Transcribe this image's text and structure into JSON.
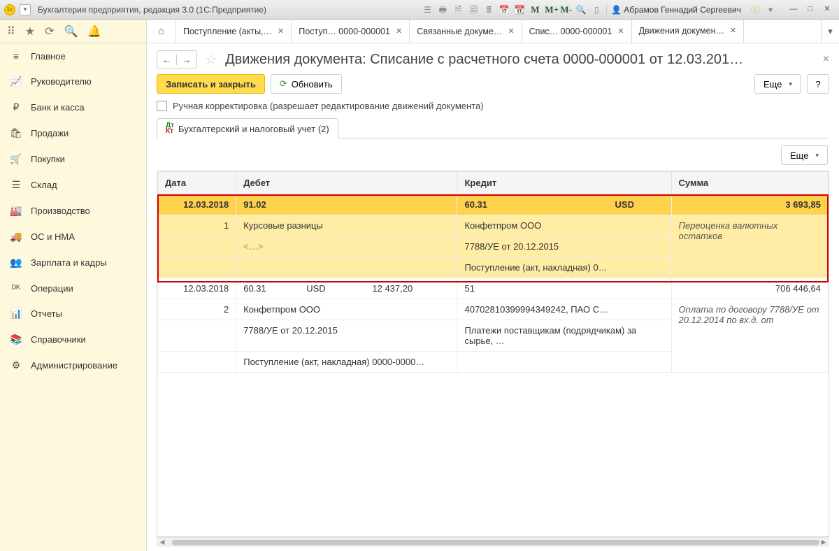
{
  "titlebar": {
    "title": "Бухгалтерия предприятия, редакция 3.0  (1С:Предприятие)",
    "m_labels": [
      "M",
      "M+",
      "M-"
    ],
    "user": "Абрамов Геннадий Сергеевич"
  },
  "sidebar": {
    "items": [
      {
        "icon": "≡",
        "label": "Главное"
      },
      {
        "icon": "📈",
        "label": "Руководителю"
      },
      {
        "icon": "₽",
        "label": "Банк и касса"
      },
      {
        "icon": "🛍",
        "label": "Продажи"
      },
      {
        "icon": "🛒",
        "label": "Покупки"
      },
      {
        "icon": "☰",
        "label": "Склад"
      },
      {
        "icon": "🏭",
        "label": "Производство"
      },
      {
        "icon": "🚚",
        "label": "ОС и НМА"
      },
      {
        "icon": "👥",
        "label": "Зарплата и кадры"
      },
      {
        "icon": "ᴰᴷ",
        "label": "Операции"
      },
      {
        "icon": "📊",
        "label": "Отчеты"
      },
      {
        "icon": "📚",
        "label": "Справочники"
      },
      {
        "icon": "⚙",
        "label": "Администрирование"
      }
    ]
  },
  "tabs": [
    {
      "label": "Поступление (акты,…"
    },
    {
      "label": "Поступ… 0000-000001"
    },
    {
      "label": "Связанные докуме…"
    },
    {
      "label": "Спис… 0000-000001"
    },
    {
      "label": "Движения докумен…",
      "active": true
    }
  ],
  "page": {
    "title": "Движения документа: Списание с расчетного счета 0000-000001 от 12.03.201…",
    "save_close": "Записать и закрыть",
    "refresh": "Обновить",
    "more": "Еще",
    "help": "?",
    "manual_correction": "Ручная корректировка (разрешает редактирование движений документа)",
    "inner_tab": "Бухгалтерский и налоговый учет (2)"
  },
  "table": {
    "headers": {
      "date": "Дата",
      "debit": "Дебет",
      "credit": "Кредит",
      "sum": "Сумма"
    },
    "group1": {
      "date": "12.03.2018",
      "num": "1",
      "debit_acct": "91.02",
      "debit_l1": "Курсовые разницы",
      "debit_l2": "<…>",
      "credit_acct": "60.31",
      "credit_cur": "USD",
      "credit_l1": "Конфетпром ООО",
      "credit_l2": "7788/УЕ от 20.12.2015",
      "credit_l3": "Поступление (акт, накладная) 0…",
      "sum": "3 693,85",
      "sum_desc": "Переоценка валютных остатков"
    },
    "group2": {
      "date": "12.03.2018",
      "num": "2",
      "debit_acct": "60.31",
      "debit_cur": "USD",
      "debit_amt": "12 437,20",
      "debit_l1": "Конфетпром ООО",
      "debit_l2": "7788/УЕ от 20.12.2015",
      "debit_l3": "Поступление (акт, накладная) 0000-0000…",
      "credit_acct": "51",
      "credit_l1": "40702810399994349242, ПАО С…",
      "credit_l2": "Платежи поставщикам (подрядчикам) за сырье, …",
      "sum": "706 446,64",
      "sum_desc": "Оплата по договору 7788/УЕ от 20.12.2014 по вх.д.  от"
    }
  }
}
